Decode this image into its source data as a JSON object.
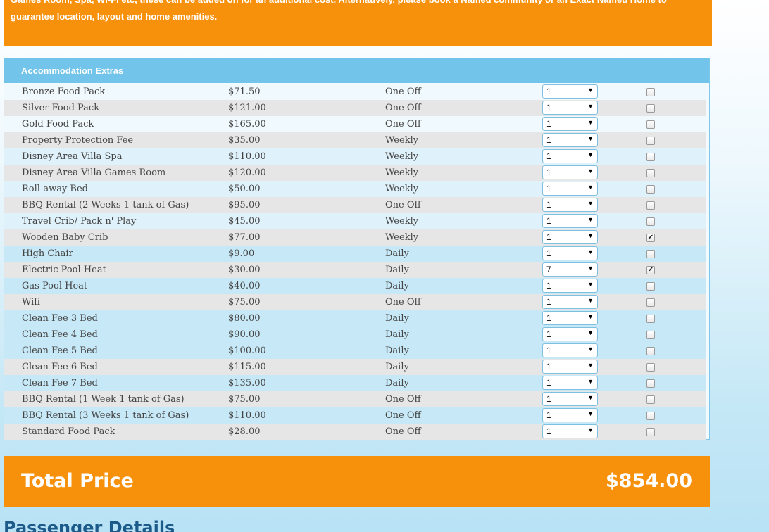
{
  "notice": {
    "line1": "Games Room, Spa, Wi-Fi etc, these can be added on for an additional cost. Alternatively, please book a Named community or an Exact Named Home to",
    "line2": "guarantee location, layout and home amenities."
  },
  "extras": {
    "title": "Accommodation Extras",
    "items": [
      {
        "name": "Bronze Food Pack",
        "price": "$71.50",
        "frequency": "One Off",
        "qty": "1",
        "checked": false
      },
      {
        "name": "Silver Food Pack",
        "price": "$121.00",
        "frequency": "One Off",
        "qty": "1",
        "checked": false
      },
      {
        "name": "Gold Food Pack",
        "price": "$165.00",
        "frequency": "One Off",
        "qty": "1",
        "checked": false
      },
      {
        "name": "Property Protection Fee",
        "price": "$35.00",
        "frequency": "Weekly",
        "qty": "1",
        "checked": false
      },
      {
        "name": "Disney Area Villa Spa",
        "price": "$110.00",
        "frequency": "Weekly",
        "qty": "1",
        "checked": false
      },
      {
        "name": "Disney Area Villa Games Room",
        "price": "$120.00",
        "frequency": "Weekly",
        "qty": "1",
        "checked": false
      },
      {
        "name": "Roll-away Bed",
        "price": "$50.00",
        "frequency": "Weekly",
        "qty": "1",
        "checked": false
      },
      {
        "name": "BBQ Rental (2 Weeks 1 tank of Gas)",
        "price": "$95.00",
        "frequency": "One Off",
        "qty": "1",
        "checked": false
      },
      {
        "name": "Travel Crib/ Pack n' Play",
        "price": "$45.00",
        "frequency": "Weekly",
        "qty": "1",
        "checked": false
      },
      {
        "name": "Wooden Baby Crib",
        "price": "$77.00",
        "frequency": "Weekly",
        "qty": "1",
        "checked": true
      },
      {
        "name": "High Chair",
        "price": "$9.00",
        "frequency": "Daily",
        "qty": "1",
        "checked": false
      },
      {
        "name": "Electric Pool Heat",
        "price": "$30.00",
        "frequency": "Daily",
        "qty": "7",
        "checked": true
      },
      {
        "name": "Gas Pool Heat",
        "price": "$40.00",
        "frequency": "Daily",
        "qty": "1",
        "checked": false
      },
      {
        "name": "Wifi",
        "price": "$75.00",
        "frequency": "One Off",
        "qty": "1",
        "checked": false
      },
      {
        "name": "Clean Fee 3 Bed",
        "price": "$80.00",
        "frequency": "Daily",
        "qty": "1",
        "checked": false
      },
      {
        "name": "Clean Fee 4 Bed",
        "price": "$90.00",
        "frequency": "Daily",
        "qty": "1",
        "checked": false
      },
      {
        "name": "Clean Fee 5 Bed",
        "price": "$100.00",
        "frequency": "Daily",
        "qty": "1",
        "checked": false
      },
      {
        "name": "Clean Fee 6 Bed",
        "price": "$115.00",
        "frequency": "Daily",
        "qty": "1",
        "checked": false
      },
      {
        "name": "Clean Fee 7 Bed",
        "price": "$135.00",
        "frequency": "Daily",
        "qty": "1",
        "checked": false
      },
      {
        "name": "BBQ Rental (1 Week 1 tank of Gas)",
        "price": "$75.00",
        "frequency": "One Off",
        "qty": "1",
        "checked": false
      },
      {
        "name": "BBQ Rental (3 Weeks 1 tank of Gas)",
        "price": "$110.00",
        "frequency": "One Off",
        "qty": "1",
        "checked": false
      },
      {
        "name": "Standard Food Pack",
        "price": "$28.00",
        "frequency": "One Off",
        "qty": "1",
        "checked": false
      }
    ]
  },
  "total": {
    "label": "Total Price",
    "value": "$854.00"
  },
  "passenger": {
    "heading": "Passenger Details"
  },
  "colors": {
    "accent_orange": "#f7900a",
    "header_blue": "#73c4ea",
    "heading_navy": "#1c5a8a"
  },
  "icons": {
    "dropdown": "chevron-down-icon",
    "checkmark": "checkmark-icon"
  }
}
